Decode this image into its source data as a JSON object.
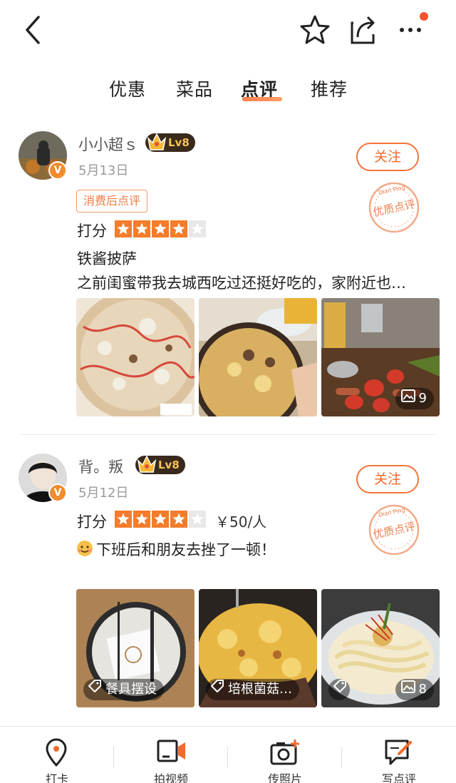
{
  "tabs": [
    {
      "label": "优惠"
    },
    {
      "label": "菜品"
    },
    {
      "label": "点评"
    },
    {
      "label": "推荐"
    }
  ],
  "active_tab": "点评",
  "colors": {
    "accent": "#f26a2c",
    "star": "#f57c2a",
    "badge": "#f18c2e"
  },
  "reviews": [
    {
      "username": "小小超ｓ",
      "level": "Lv8",
      "date": "5月13日",
      "follow_label": "关注",
      "tag": "消费后点评",
      "score_label": "打分",
      "rating": 4,
      "dish": "铁酱披萨",
      "text": "之前闺蜜带我去城西吃过还挺好吃的，家附近也…",
      "stamp_text": "优质点评",
      "stamp_sub": "Dian Ping",
      "photo_count": "9"
    },
    {
      "username": "背。叛",
      "level": "Lv8",
      "date": "5月12日",
      "follow_label": "关注",
      "score_label": "打分",
      "rating": 4,
      "price": "￥50/人",
      "text": "下班后和朋友去挫了一顿！",
      "stamp_text": "优质点评",
      "stamp_sub": "Dian Ping",
      "photo_tags": [
        "餐具摆设",
        "培根菌菇…"
      ],
      "photo_count": "8"
    }
  ],
  "bottom_bar": [
    {
      "label": "打卡",
      "icon": "location-pin-icon"
    },
    {
      "label": "拍视频",
      "icon": "video-camera-icon"
    },
    {
      "label": "传照片",
      "icon": "camera-plus-icon"
    },
    {
      "label": "写点评",
      "icon": "write-review-icon"
    }
  ]
}
